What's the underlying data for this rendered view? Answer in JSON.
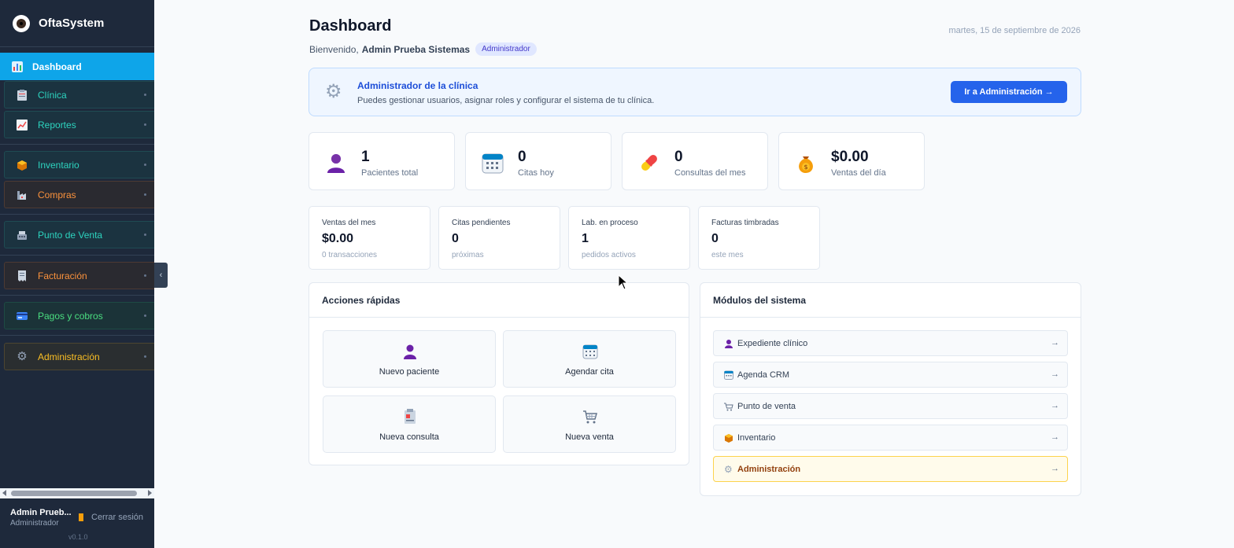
{
  "app": {
    "name": "OftaSystem",
    "version": "v0.1.0"
  },
  "sidebar": {
    "items": [
      {
        "label": "Dashboard",
        "icon": "bar-chart-icon"
      },
      {
        "label": "Clínica",
        "icon": "clipboard-icon"
      },
      {
        "label": "Reportes",
        "icon": "trend-chart-icon"
      },
      {
        "label": "Inventario",
        "icon": "box-icon"
      },
      {
        "label": "Compras",
        "icon": "factory-icon"
      },
      {
        "label": "Punto de Venta",
        "icon": "register-icon"
      },
      {
        "label": "Facturación",
        "icon": "receipt-icon"
      },
      {
        "label": "Pagos y cobros",
        "icon": "credit-card-icon"
      },
      {
        "label": "Administración",
        "icon": "gear-icon"
      }
    ],
    "user": {
      "name": "Admin Prueb...",
      "role": "Administrador"
    },
    "logout_label": "Cerrar sesión"
  },
  "header": {
    "title": "Dashboard",
    "welcome_prefix": "Bienvenido,",
    "user_name": "Admin Prueba Sistemas",
    "role_badge": "Administrador",
    "date": "martes, 15 de septiembre de 2026"
  },
  "banner": {
    "title": "Administrador de la clínica",
    "text": "Puedes gestionar usuarios, asignar roles y configurar el sistema de tu clínica.",
    "button": "Ir a Administración →"
  },
  "stats": [
    {
      "value": "1",
      "label": "Pacientes total",
      "icon": "patient-icon"
    },
    {
      "value": "0",
      "label": "Citas hoy",
      "icon": "calendar-icon"
    },
    {
      "value": "0",
      "label": "Consultas del mes",
      "icon": "pill-icon"
    },
    {
      "value": "$0.00",
      "label": "Ventas del día",
      "icon": "money-bag-icon"
    }
  ],
  "mini_stats": [
    {
      "label": "Ventas del mes",
      "value": "$0.00",
      "sub": "0 transacciones"
    },
    {
      "label": "Citas pendientes",
      "value": "0",
      "sub": "próximas"
    },
    {
      "label": "Lab. en proceso",
      "value": "1",
      "sub": "pedidos activos"
    },
    {
      "label": "Facturas timbradas",
      "value": "0",
      "sub": "este mes"
    }
  ],
  "quick_actions": {
    "title": "Acciones rápidas",
    "items": [
      {
        "label": "Nuevo paciente",
        "icon": "patient-icon"
      },
      {
        "label": "Agendar cita",
        "icon": "calendar-icon"
      },
      {
        "label": "Nueva consulta",
        "icon": "clipboard-icon"
      },
      {
        "label": "Nueva venta",
        "icon": "cart-icon"
      }
    ]
  },
  "modules": {
    "title": "Módulos del sistema",
    "items": [
      {
        "label": "Expediente clínico",
        "icon": "patient-icon",
        "arrow": "→"
      },
      {
        "label": "Agenda CRM",
        "icon": "calendar-icon",
        "arrow": "→"
      },
      {
        "label": "Punto de venta",
        "icon": "register-icon",
        "arrow": "→"
      },
      {
        "label": "Inventario",
        "icon": "box-icon",
        "arrow": "→"
      },
      {
        "label": "Administración",
        "icon": "gear-icon",
        "arrow": "→"
      }
    ]
  },
  "colors": {
    "sidebar_bg": "#1e293b",
    "active_nav": "#0ea5e9",
    "primary_button": "#2563eb"
  }
}
